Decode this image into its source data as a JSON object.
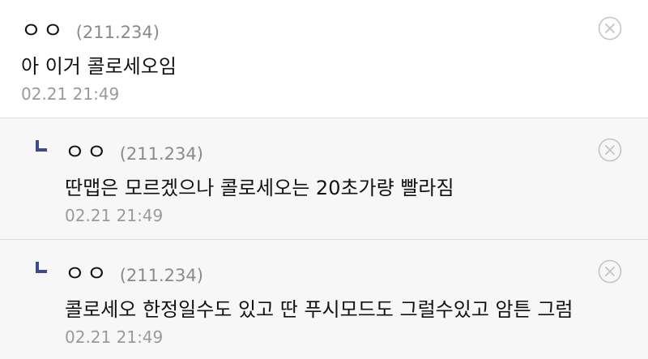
{
  "comments": [
    {
      "nick": "ㅇㅇ",
      "ip": "(211.234)",
      "text": "아 이거 콜로세오임",
      "time": "02.21 21:49"
    }
  ],
  "replies": [
    {
      "nick": "ㅇㅇ",
      "ip": "(211.234)",
      "text": "딴맵은 모르겠으나 콜로세오는 20초가량 빨라짐",
      "time": "02.21 21:49"
    },
    {
      "nick": "ㅇㅇ",
      "ip": "(211.234)",
      "text": "콜로세오 한정일수도 있고 딴 푸시모드도 그럴수있고 암튼 그럼",
      "time": "02.21 21:49"
    }
  ],
  "colors": {
    "reply_background": "#f7f7f8",
    "reply_marker": "#3d4a8c",
    "divider": "#dcdcdc",
    "meta_text": "#8a8a8a"
  },
  "icons": {
    "delete": "close-circle-icon",
    "reply": "reply-arrow-icon"
  }
}
